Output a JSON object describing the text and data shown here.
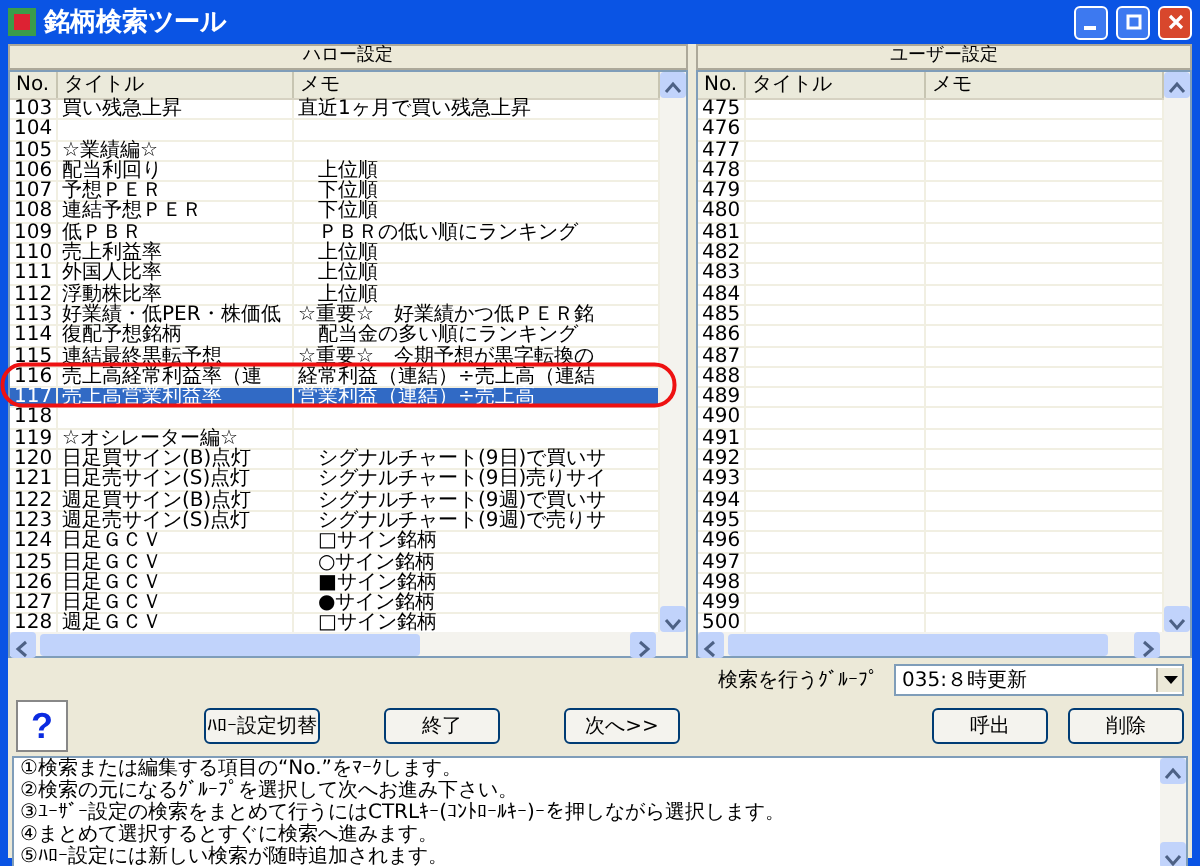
{
  "window": {
    "title": "銘柄検索ツール"
  },
  "panels": [
    {
      "header": "ハロー設定",
      "columns": [
        "No.",
        "タイトル",
        "メモ"
      ],
      "rows": [
        {
          "no": "103",
          "title": "買い残急上昇",
          "memo": "直近1ヶ月で買い残急上昇",
          "selected": false
        },
        {
          "no": "104",
          "title": "",
          "memo": "",
          "selected": false
        },
        {
          "no": "105",
          "title": "☆業績編☆",
          "memo": "",
          "selected": false
        },
        {
          "no": "106",
          "title": "配当利回り",
          "memo": "　上位順",
          "selected": false
        },
        {
          "no": "107",
          "title": "予想ＰＥＲ",
          "memo": "　下位順",
          "selected": false
        },
        {
          "no": "108",
          "title": "連結予想ＰＥＲ",
          "memo": "　下位順",
          "selected": false
        },
        {
          "no": "109",
          "title": "低ＰＢＲ",
          "memo": "　ＰＢＲの低い順にランキング",
          "selected": false
        },
        {
          "no": "110",
          "title": "売上利益率",
          "memo": "　上位順",
          "selected": false
        },
        {
          "no": "111",
          "title": "外国人比率",
          "memo": "　上位順",
          "selected": false
        },
        {
          "no": "112",
          "title": "浮動株比率",
          "memo": "　上位順",
          "selected": false
        },
        {
          "no": "113",
          "title": "好業績・低PER・株価低",
          "memo": "☆重要☆　好業績かつ低ＰＥＲ銘",
          "selected": false
        },
        {
          "no": "114",
          "title": "復配予想銘柄",
          "memo": "　配当金の多い順にランキング",
          "selected": false
        },
        {
          "no": "115",
          "title": "連結最終黒転予想",
          "memo": "☆重要☆　今期予想が黒字転換の",
          "selected": false
        },
        {
          "no": "116",
          "title": "売上高経常利益率（連",
          "memo": "経常利益（連結）÷売上高（連結",
          "selected": false
        },
        {
          "no": "117",
          "title": "売上高営業利益率",
          "memo": "営業利益（連結）÷売上高",
          "selected": true
        },
        {
          "no": "118",
          "title": "",
          "memo": "",
          "selected": false
        },
        {
          "no": "119",
          "title": "☆オシレーター編☆",
          "memo": "",
          "selected": false
        },
        {
          "no": "120",
          "title": "日足買サイン(B)点灯",
          "memo": "　シグナルチャート(9日)で買いサ",
          "selected": false
        },
        {
          "no": "121",
          "title": "日足売サイン(S)点灯",
          "memo": "　シグナルチャート(9日)売りサイ",
          "selected": false
        },
        {
          "no": "122",
          "title": "週足買サイン(B)点灯",
          "memo": "　シグナルチャート(9週)で買いサ",
          "selected": false
        },
        {
          "no": "123",
          "title": "週足売サイン(S)点灯",
          "memo": "　シグナルチャート(9週)で売りサ",
          "selected": false
        },
        {
          "no": "124",
          "title": "日足ＧＣＶ",
          "memo": "　□サイン銘柄",
          "selected": false
        },
        {
          "no": "125",
          "title": "日足ＧＣＶ",
          "memo": "　○サイン銘柄",
          "selected": false
        },
        {
          "no": "126",
          "title": "日足ＧＣＶ",
          "memo": "　■サイン銘柄",
          "selected": false
        },
        {
          "no": "127",
          "title": "日足ＧＣＶ",
          "memo": "　●サイン銘柄",
          "selected": false
        },
        {
          "no": "128",
          "title": "週足ＧＣＶ",
          "memo": "　□サイン銘柄",
          "selected": false
        }
      ]
    },
    {
      "header": "ユーザー設定",
      "columns": [
        "No.",
        "タイトル",
        "メモ"
      ],
      "rows": [
        {
          "no": "475",
          "title": "",
          "memo": "",
          "selected": false
        },
        {
          "no": "476",
          "title": "",
          "memo": "",
          "selected": false
        },
        {
          "no": "477",
          "title": "",
          "memo": "",
          "selected": false
        },
        {
          "no": "478",
          "title": "",
          "memo": "",
          "selected": false
        },
        {
          "no": "479",
          "title": "",
          "memo": "",
          "selected": false
        },
        {
          "no": "480",
          "title": "",
          "memo": "",
          "selected": false
        },
        {
          "no": "481",
          "title": "",
          "memo": "",
          "selected": false
        },
        {
          "no": "482",
          "title": "",
          "memo": "",
          "selected": false
        },
        {
          "no": "483",
          "title": "",
          "memo": "",
          "selected": false
        },
        {
          "no": "484",
          "title": "",
          "memo": "",
          "selected": false
        },
        {
          "no": "485",
          "title": "",
          "memo": "",
          "selected": false
        },
        {
          "no": "486",
          "title": "",
          "memo": "",
          "selected": false
        },
        {
          "no": "487",
          "title": "",
          "memo": "",
          "selected": false
        },
        {
          "no": "488",
          "title": "",
          "memo": "",
          "selected": false
        },
        {
          "no": "489",
          "title": "",
          "memo": "",
          "selected": false
        },
        {
          "no": "490",
          "title": "",
          "memo": "",
          "selected": false
        },
        {
          "no": "491",
          "title": "",
          "memo": "",
          "selected": false
        },
        {
          "no": "492",
          "title": "",
          "memo": "",
          "selected": false
        },
        {
          "no": "493",
          "title": "",
          "memo": "",
          "selected": false
        },
        {
          "no": "494",
          "title": "",
          "memo": "",
          "selected": false
        },
        {
          "no": "495",
          "title": "",
          "memo": "",
          "selected": false
        },
        {
          "no": "496",
          "title": "",
          "memo": "",
          "selected": false
        },
        {
          "no": "497",
          "title": "",
          "memo": "",
          "selected": false
        },
        {
          "no": "498",
          "title": "",
          "memo": "",
          "selected": false
        },
        {
          "no": "499",
          "title": "",
          "memo": "",
          "selected": false
        },
        {
          "no": "500",
          "title": "",
          "memo": "",
          "selected": false
        }
      ]
    }
  ],
  "group_selector": {
    "label": "検索を行うｸﾞﾙｰﾌﾟ",
    "value": "035:８時更新"
  },
  "help_button": {
    "glyph": "?"
  },
  "buttons": [
    {
      "label": "ﾊﾛｰ設定切替",
      "kind": "center"
    },
    {
      "label": "終了",
      "kind": "center"
    },
    {
      "label": "次へ>>",
      "kind": "center"
    },
    {
      "label": "呼出",
      "kind": "right"
    },
    {
      "label": "削除",
      "kind": "right"
    }
  ],
  "help_lines": [
    "①検索または編集する項目の“No.”をﾏｰｸします。",
    "②検索の元になるｸﾞﾙｰﾌﾟを選択して次へお進み下さい。",
    "③ﾕｰｻﾞｰ設定の検索をまとめて行うにはCTRLｷｰ(ｺﾝﾄﾛｰﾙｷｰ)ｰを押しながら選択します。",
    "④まとめて選択するとすぐに検索へ進みます。",
    "⑤ﾊﾛｰ設定には新しい検索が随時追加されます。"
  ]
}
